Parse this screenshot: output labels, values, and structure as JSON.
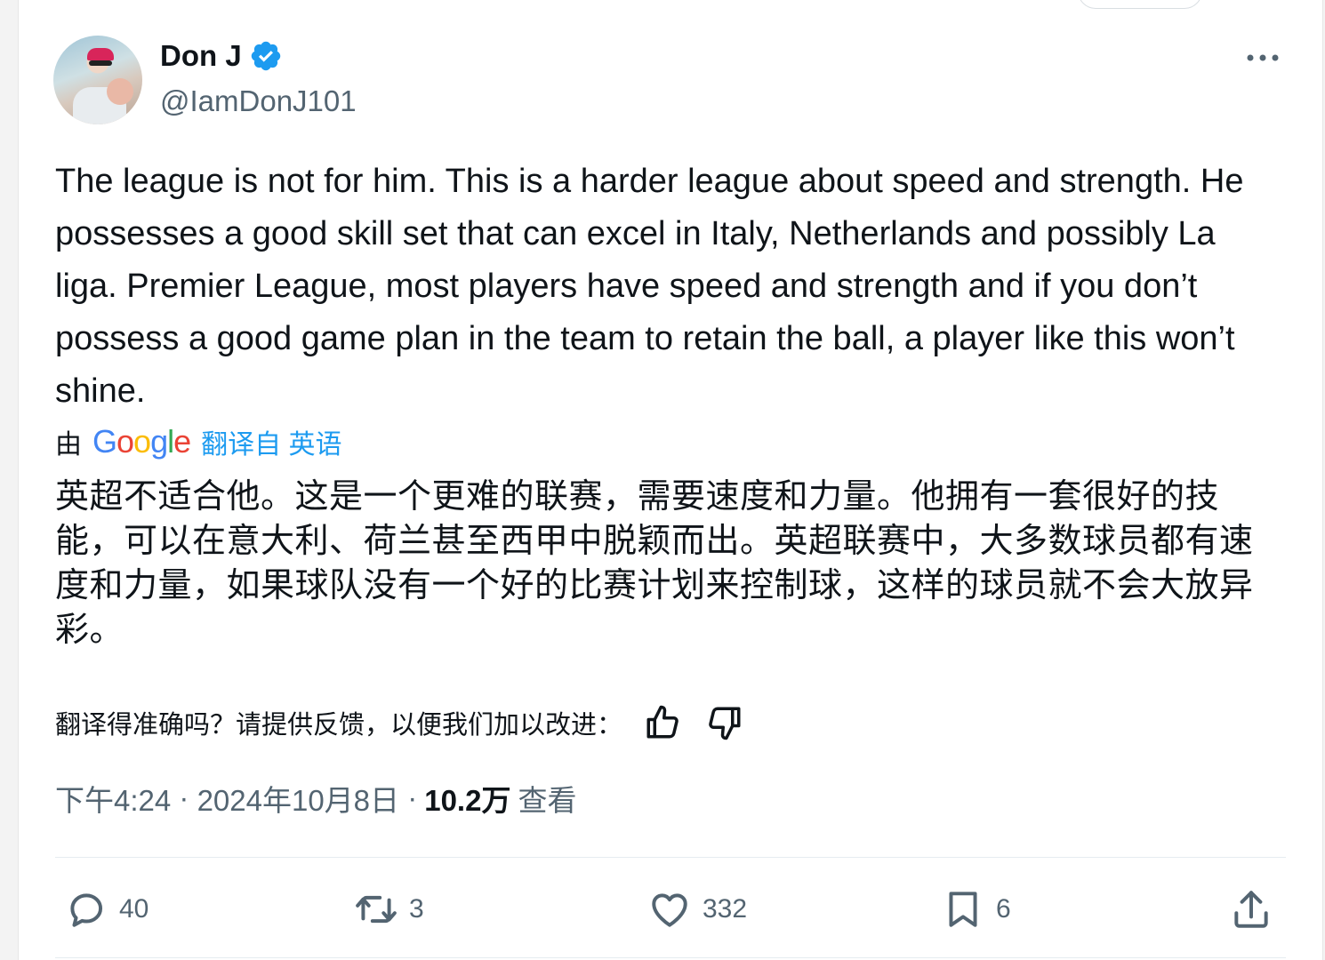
{
  "author": {
    "name": "Don J",
    "handle": "@IamDonJ101",
    "verified": true
  },
  "tweet": {
    "text": "The league is not for him. This is a harder league about speed and strength. He possesses a good skill set that can excel in Italy, Netherlands and possibly La liga. Premier League, most players have speed and strength and if you don’t possess a good game plan in the team to retain the ball, a player like this won’t shine.",
    "translation_by": "由",
    "google": "Google",
    "translated_from": "翻译自 英语",
    "translated_text": "英超不适合他。这是一个更难的联赛，需要速度和力量。他拥有一套很好的技能，可以在意大利、荷兰甚至西甲中脱颖而出。英超联赛中，大多数球员都有速度和力量，如果球队没有一个好的比赛计划来控制球，这样的球员就不会大放异彩。",
    "feedback_prompt": "翻译得准确吗？请提供反馈，以便我们加以改进：",
    "time": "下午4:24",
    "date": "2024年10月8日",
    "views_count": "10.2万",
    "views_label": "查看"
  },
  "actions": {
    "replies": "40",
    "retweets": "3",
    "likes": "332",
    "bookmarks": "6"
  },
  "icons": [
    "verified-badge-icon",
    "more-icon",
    "thumbs-up-icon",
    "thumbs-down-icon",
    "reply-icon",
    "retweet-icon",
    "like-icon",
    "bookmark-icon",
    "share-icon"
  ],
  "colors": {
    "accent": "#1d9bf0",
    "text": "#0f1419",
    "secondary": "#536471"
  }
}
